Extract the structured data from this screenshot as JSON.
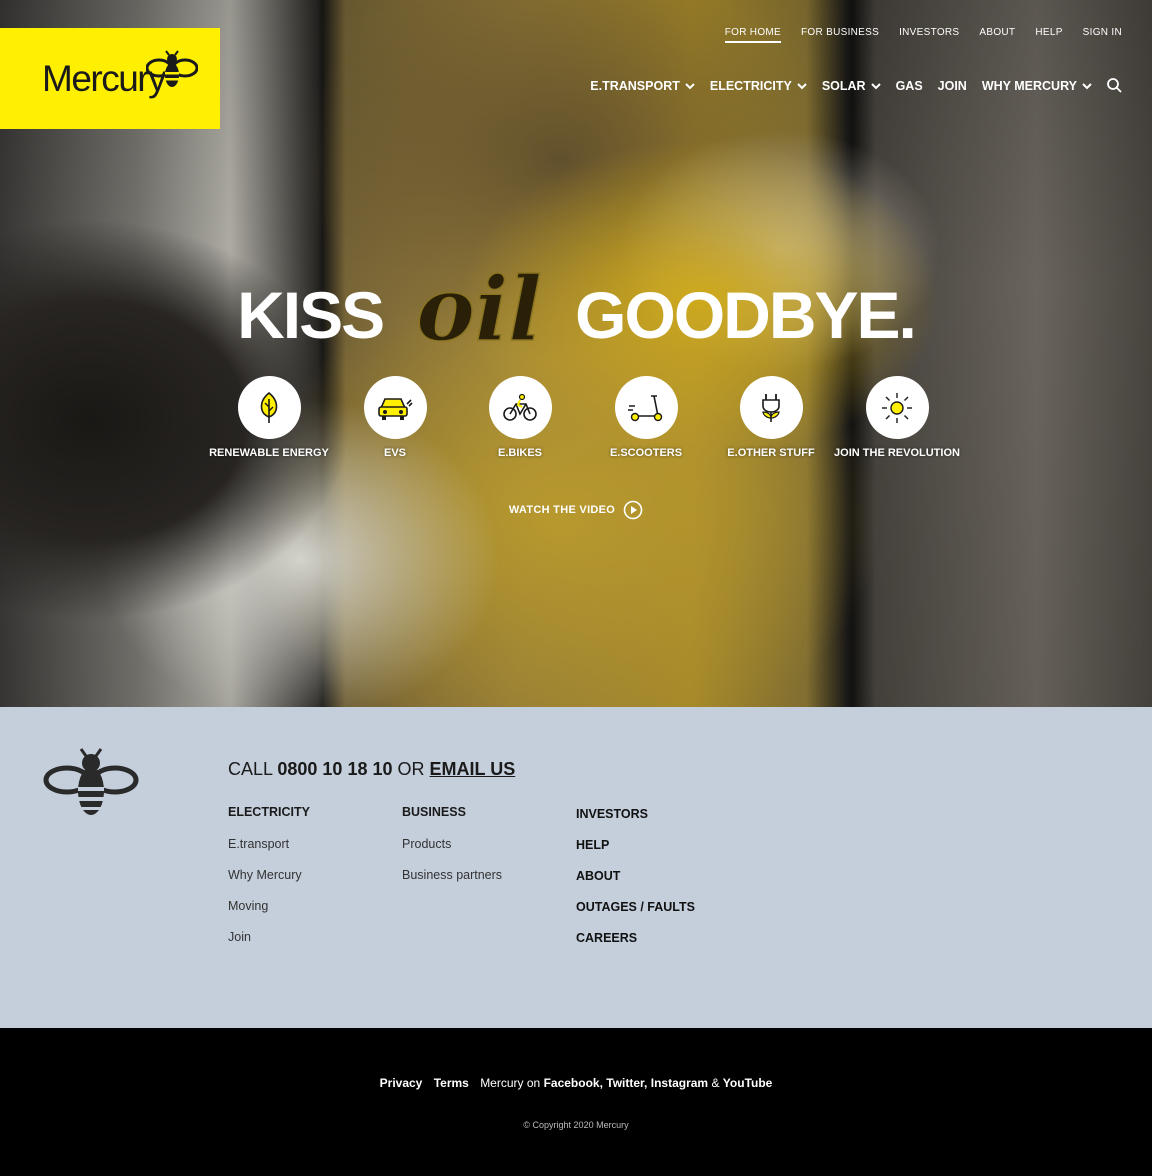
{
  "brand": {
    "name": "Mercury",
    "accent": "#ffef00",
    "footer_bg": "#c5cfdc"
  },
  "topnav": [
    "FOR HOME",
    "FOR BUSINESS",
    "INVESTORS",
    "ABOUT",
    "HELP",
    "SIGN IN"
  ],
  "mainnav": [
    "E.TRANSPORT",
    "ELECTRICITY",
    "SOLAR",
    "GAS",
    "JOIN",
    "WHY MERCURY"
  ],
  "hero": {
    "headline_left": "KISS",
    "headline_script": "oil",
    "headline_right": "GOODBYE.",
    "icons": [
      {
        "label": "RENEWABLE ENERGY",
        "icon": "leaf-icon"
      },
      {
        "label": "EVS",
        "icon": "car-icon"
      },
      {
        "label": "E.BIKES",
        "icon": "bike-icon"
      },
      {
        "label": "E.SCOOTERS",
        "icon": "scooter-icon"
      },
      {
        "label": "E.OTHER STUFF",
        "icon": "plug-icon"
      },
      {
        "label": "JOIN THE REVOLUTION",
        "icon": "sun-icon"
      }
    ],
    "watch_label": "WATCH THE VIDEO"
  },
  "footer": {
    "call_prefix": "CALL",
    "phone": "0800 10 18 10",
    "or": "OR",
    "email": "EMAIL US",
    "col1": {
      "heading": "ELECTRICITY",
      "links": [
        "E.transport",
        "Why Mercury",
        "Moving",
        "Join"
      ]
    },
    "col2": {
      "heading": "BUSINESS",
      "links": [
        "Products",
        "Business partners"
      ]
    },
    "col3": [
      "INVESTORS",
      "HELP",
      "ABOUT",
      "OUTAGES / FAULTS",
      "CAREERS"
    ]
  },
  "bottom": {
    "privacy": "Privacy",
    "terms": "Terms",
    "mercury_on": "Mercury on",
    "facebook": "Facebook,",
    "twitter": "Twitter,",
    "instagram": "Instagram",
    "amp": "&",
    "youtube": "YouTube",
    "copyright": "© Copyright 2020 Mercury"
  }
}
